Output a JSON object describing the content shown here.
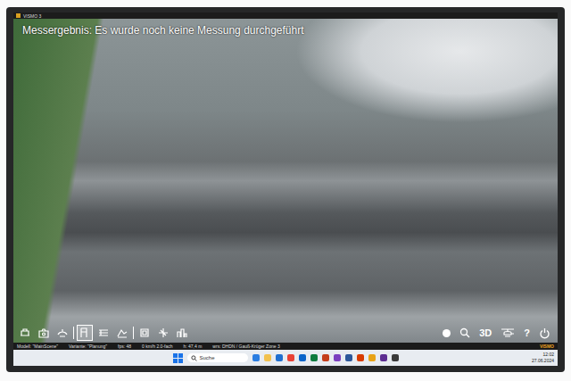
{
  "window": {
    "title": "VISMO 3"
  },
  "viewport": {
    "measurement": "Messergebnis: Es wurde noch keine Messung durchgeführt"
  },
  "toolbar": {
    "tools": [
      {
        "selected": false
      },
      {
        "selected": false
      },
      {
        "selected": false
      },
      {
        "selected": true
      },
      {
        "selected": false
      },
      {
        "selected": false
      },
      {
        "selected": false
      },
      {
        "selected": false
      },
      {
        "selected": false
      }
    ],
    "view_3d": "3D",
    "help": "?"
  },
  "status_bar": {
    "items": [
      "Modell: \"MainScene\"",
      "Variante: \"Planung\"",
      "fps: 48",
      "0 km/h 2.0-fach",
      "h: 47,4 m",
      "wrs: DHDN / Gauß-Krüger Zone 3"
    ],
    "brand": "VISMO"
  },
  "taskbar": {
    "search": {
      "placeholder": "Suche"
    },
    "apps": [
      {
        "color": "#2a7de1"
      },
      {
        "color": "#f2c14e"
      },
      {
        "color": "#1f6fd0"
      },
      {
        "color": "#e94235"
      },
      {
        "color": "#0a64c9"
      },
      {
        "color": "#0f7b3f"
      },
      {
        "color": "#c43e1c"
      },
      {
        "color": "#7b3fbf"
      },
      {
        "color": "#2b579a"
      },
      {
        "color": "#d83b01"
      },
      {
        "color": "#e8a317"
      },
      {
        "color": "#5c2d91"
      },
      {
        "color": "#3a3a3a"
      }
    ],
    "clock": {
      "time": "12:02",
      "date": "27.06.2024"
    }
  }
}
